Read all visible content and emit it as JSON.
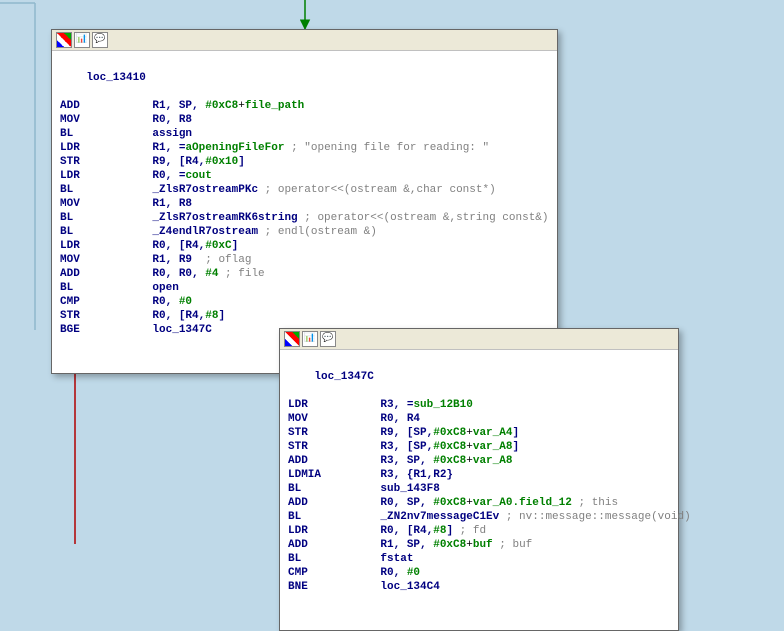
{
  "node1": {
    "label": "loc_13410",
    "lines": [
      {
        "mn": "ADD",
        "c1": "R1, SP, ",
        "n": "#0xC8",
        "t": "+",
        "s": "file_path"
      },
      {
        "mn": "MOV",
        "c1": "R0, R8"
      },
      {
        "mn": "BL",
        "f": "assign"
      },
      {
        "mn": "LDR",
        "c1": "R1, =",
        "s": "aOpeningFileFor",
        "cmt": " ; \"opening file for reading: \""
      },
      {
        "mn": "STR",
        "c1": "R9, [R4,",
        "n": "#0x10",
        "c2": "]"
      },
      {
        "mn": "LDR",
        "c1": "R0, =",
        "s": "cout"
      },
      {
        "mn": "BL",
        "f": "_ZlsR7ostreamPKc",
        "cmt": " ; operator<<(ostream &,char const*)"
      },
      {
        "mn": "MOV",
        "c1": "R1, R8"
      },
      {
        "mn": "BL",
        "f": "_ZlsR7ostreamRK6string",
        "cmt": " ; operator<<(ostream &,string const&)"
      },
      {
        "mn": "BL",
        "f": "_Z4endlR7ostream",
        "cmt": " ; endl(ostream &)"
      },
      {
        "mn": "LDR",
        "c1": "R0, [R4,",
        "n": "#0xC",
        "c2": "]"
      },
      {
        "mn": "MOV",
        "c1": "R1, R9 ",
        "cmt": " ; oflag"
      },
      {
        "mn": "ADD",
        "c1": "R0, R0, ",
        "n": "#4",
        "cmt": " ; file"
      },
      {
        "mn": "BL",
        "f": "open"
      },
      {
        "mn": "CMP",
        "c1": "R0, ",
        "n": "#0"
      },
      {
        "mn": "STR",
        "c1": "R0, [R4,",
        "n": "#8",
        "c2": "]"
      },
      {
        "mn": "BGE",
        "f": "loc_1347C"
      }
    ]
  },
  "node2": {
    "label": "loc_1347C",
    "lines": [
      {
        "mn": "LDR",
        "c1": "R3, =",
        "s": "sub_12B10"
      },
      {
        "mn": "MOV",
        "c1": "R0, R4"
      },
      {
        "mn": "STR",
        "c1": "R9, [SP,",
        "n": "#0xC8",
        "t": "+",
        "s": "var_A4",
        "c2": "]"
      },
      {
        "mn": "STR",
        "c1": "R3, [SP,",
        "n": "#0xC8",
        "t": "+",
        "s": "var_A8",
        "c2": "]"
      },
      {
        "mn": "ADD",
        "c1": "R3, SP, ",
        "n": "#0xC8",
        "t": "+",
        "s": "var_A8"
      },
      {
        "mn": "LDMIA",
        "c1": "R3, {R1,R2}"
      },
      {
        "mn": "BL",
        "f": "sub_143F8"
      },
      {
        "mn": "ADD",
        "c1": "R0, SP, ",
        "n": "#0xC8",
        "t": "+",
        "s": "var_A0.field_12",
        "cmt": " ; this"
      },
      {
        "mn": "BL",
        "f": "_ZN2nv7messageC1Ev",
        "cmt": " ; nv::message::message(void)"
      },
      {
        "mn": "LDR",
        "c1": "R0, [R4,",
        "n": "#8",
        "c2": "]",
        "cmt": " ; fd"
      },
      {
        "mn": "ADD",
        "c1": "R1, SP, ",
        "n": "#0xC8",
        "t": "+",
        "s": "buf",
        "cmt": " ; buf"
      },
      {
        "mn": "BL",
        "f": "fstat"
      },
      {
        "mn": "CMP",
        "c1": "R0, ",
        "n": "#0"
      },
      {
        "mn": "BNE",
        "f": "loc_134C4"
      }
    ]
  }
}
